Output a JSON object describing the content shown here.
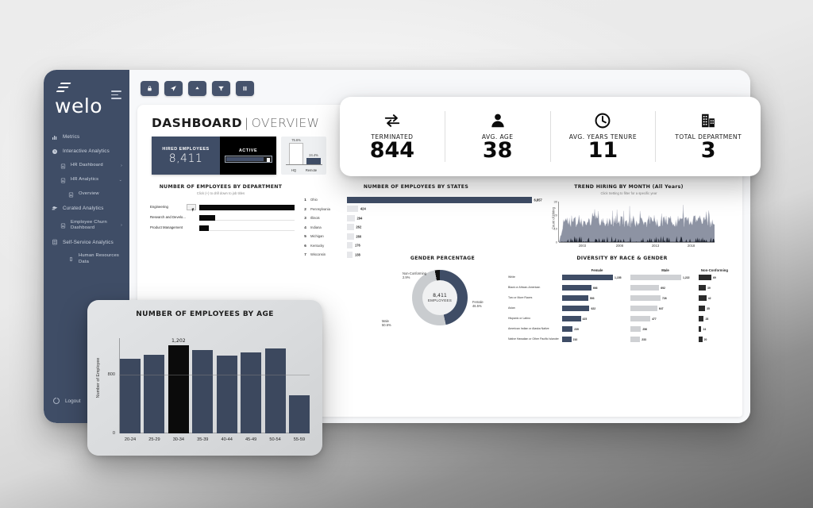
{
  "brand": {
    "name": "welo",
    "logo_icon": "welo-logo-icon",
    "menu_icon": "hamburger-icon"
  },
  "sidebar": {
    "items": [
      {
        "label": "Metrics",
        "icon": "bar-chart-icon",
        "level": 1,
        "caret": ""
      },
      {
        "label": "Interactive Analytics",
        "icon": "clock-icon",
        "level": 1,
        "caret": ""
      },
      {
        "label": "HR Dashboard",
        "icon": "document-chart-icon",
        "level": 2,
        "caret": "›"
      },
      {
        "label": "HR Analytics",
        "icon": "document-chart-icon",
        "level": 2,
        "caret": "⌄"
      },
      {
        "label": "Overview",
        "icon": "document-chart-icon",
        "level": 3,
        "caret": ""
      },
      {
        "label": "Curated Analytics",
        "icon": "layers-icon",
        "level": 1,
        "caret": ""
      },
      {
        "label": "Employee Churn Dashboard",
        "icon": "document-chart-icon",
        "level": 2,
        "caret": "›"
      },
      {
        "label": "Self-Service Analytics",
        "icon": "database-icon",
        "level": 1,
        "caret": ""
      },
      {
        "label": "Human Resources Data",
        "icon": "cylinder-icon",
        "level": 3,
        "caret": ""
      }
    ],
    "logout": {
      "label": "Logout",
      "icon": "power-icon"
    }
  },
  "toolbar": {
    "buttons": [
      {
        "name": "lock-button",
        "icon": "lock-icon"
      },
      {
        "name": "send-button",
        "icon": "paper-plane-icon"
      },
      {
        "name": "upload-button",
        "icon": "cloud-upload-icon"
      },
      {
        "name": "filter-button",
        "icon": "filter-icon"
      },
      {
        "name": "pause-button",
        "icon": "pause-icon"
      }
    ]
  },
  "header": {
    "title_bold": "DASHBOARD",
    "separator": "|",
    "title_normal": "OVERVIEW",
    "accent_color": "#5fc98b"
  },
  "hired": {
    "label": "HIRED EMPLOYEES",
    "value": "8,411",
    "toggle_label": "ACTIVE"
  },
  "kpis": [
    {
      "label": "TERMINATED",
      "value": "844",
      "icon": "exchange-arrows-icon"
    },
    {
      "label": "AVG. AGE",
      "value": "38",
      "icon": "person-icon"
    },
    {
      "label": "AVG. YEARS TENURE",
      "value": "11",
      "icon": "clock-icon"
    },
    {
      "label": "TOTAL DEPARTMENT",
      "value": "3",
      "icon": "building-icon"
    }
  ],
  "chart_data": [
    {
      "type": "bar",
      "id": "location-split",
      "title": "",
      "categories": [
        "HQ",
        "Remote"
      ],
      "values": [
        75.6,
        24.4
      ],
      "labels": [
        "75.6%",
        "24.4%"
      ],
      "ylim": [
        0,
        80
      ],
      "ylabel": "",
      "grid": false
    },
    {
      "type": "bar",
      "id": "employees-by-department",
      "title": "NUMBER OF EMPLOYEES BY DEPARTMENT",
      "subtitle": "Click (+) to drill down to job titles",
      "orientation": "horizontal",
      "categories": [
        "Engineering",
        "Research and Develo...",
        "Product Management"
      ],
      "values": [
        100,
        17,
        10
      ],
      "ylabel": "",
      "xlabel": "",
      "grid": true
    },
    {
      "type": "bar",
      "id": "employees-by-states",
      "title": "NUMBER OF EMPLOYEES BY STATES",
      "orientation": "horizontal",
      "ranks": [
        "1",
        "2",
        "3",
        "4",
        "5",
        "6",
        "7"
      ],
      "categories": [
        "Ohio",
        "Pennsylvania",
        "Illinois",
        "Indiana",
        "Michigan",
        "Kentucky",
        "Wisconsin"
      ],
      "values": [
        6857,
        424,
        294,
        262,
        260,
        176,
        138
      ],
      "labels": [
        "6,857",
        "424",
        "294",
        "262",
        "260",
        "176",
        "138"
      ],
      "xlim": [
        0,
        6857
      ],
      "grid": false
    },
    {
      "type": "area",
      "id": "trend-hiring-by-month",
      "title": "TREND HIRING BY MONTH (All Years)",
      "subtitle": "Click Setting to filter for a specific year",
      "ylabel": "Count of Hiring",
      "xlabel": "",
      "yticks": [
        "0",
        "10",
        "20",
        "30"
      ],
      "ylim": [
        0,
        30
      ],
      "xticks": [
        "2003",
        "2008",
        "2013",
        "2018"
      ],
      "grid": false
    },
    {
      "type": "bar",
      "id": "employees-by-age",
      "title": "NUMBER OF EMPLOYEES BY AGE",
      "ylabel": "Number of Employee",
      "xlabel": "",
      "categories": [
        "20-24",
        "25-29",
        "30-34",
        "35-39",
        "40-44",
        "45-49",
        "50-54",
        "55-59"
      ],
      "values": [
        1020,
        1075,
        1202,
        1135,
        1065,
        1110,
        1160,
        520
      ],
      "highlight_index": 2,
      "highlight_label": "1,202",
      "yticks": [
        "0",
        "800"
      ],
      "ylim": [
        0,
        1300
      ],
      "grid": true
    },
    {
      "type": "pie",
      "id": "gender-percentage",
      "title": "GENDER PERCENTAGE",
      "center_value": "8,411",
      "center_label": "EMPLOYEES",
      "labels": [
        "Female",
        "Male",
        "Non-Conforming"
      ],
      "values": [
        46.5,
        50.6,
        2.9
      ],
      "value_labels": [
        "46.5%",
        "50.6%",
        "2.9%"
      ],
      "colors": [
        "#3f4d66",
        "#c9cccf",
        "#111111"
      ]
    },
    {
      "type": "bar",
      "id": "diversity-by-race-and-gender",
      "title": "DIVERSITY BY RACE & GENDER",
      "orientation": "horizontal",
      "categories": [
        "White",
        "Black or African-American",
        "Two or More Races",
        "Asian",
        "Hispanic or Latino",
        "American Indian or Alaska Native",
        "Native Hawaiian or Other Pacific Islander"
      ],
      "series": [
        {
          "name": "Female",
          "values": [
            1155,
            666,
            593,
            622,
            425,
            239,
            210
          ],
          "labels": [
            "1,155",
            "666",
            "593",
            "622",
            "425",
            "239",
            "210"
          ]
        },
        {
          "name": "Male",
          "values": [
            1222,
            692,
            726,
            647,
            477,
            256,
            233
          ],
          "labels": [
            "1,222",
            "692",
            "726",
            "647",
            "477",
            "256",
            "233"
          ]
        },
        {
          "name": "Non-Conforming",
          "values": [
            69,
            39,
            42,
            35,
            28,
            15,
            20
          ],
          "labels": [
            "69",
            "39",
            "42",
            "35",
            "28",
            "24",
            "20"
          ]
        }
      ],
      "grid": false
    }
  ]
}
